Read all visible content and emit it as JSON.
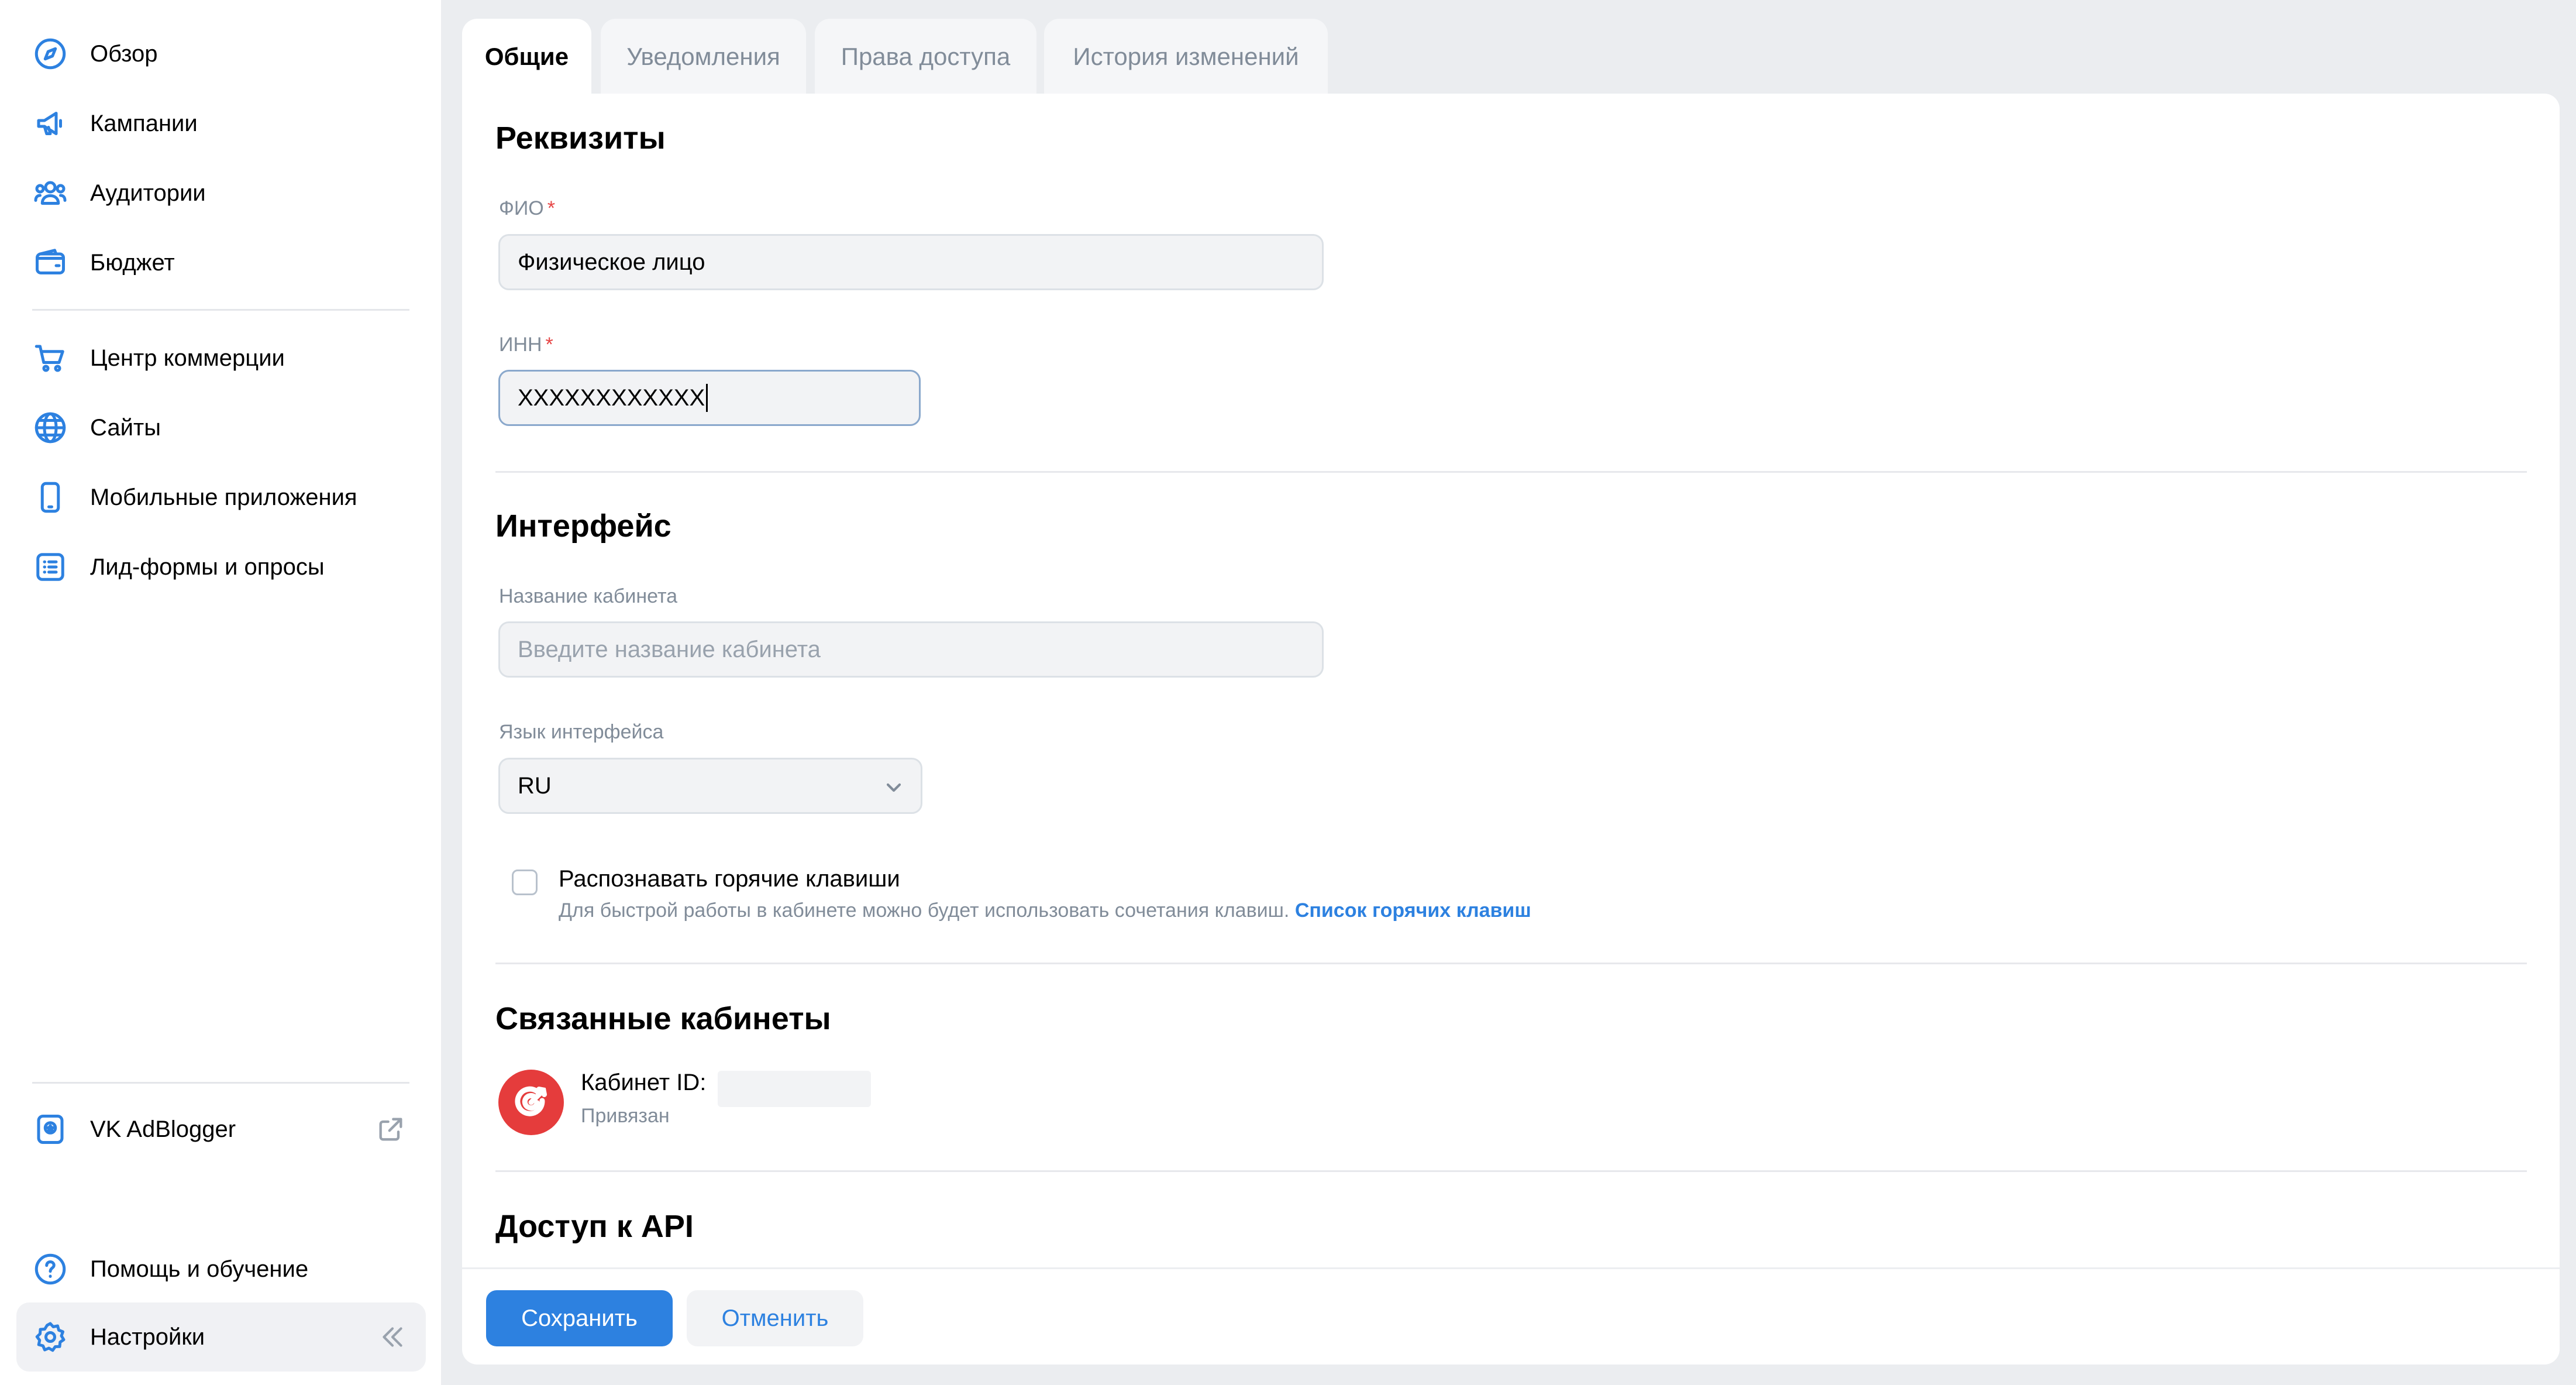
{
  "sidebar": {
    "items": [
      {
        "label": "Обзор",
        "icon": "compass-icon"
      },
      {
        "label": "Кампании",
        "icon": "megaphone-icon"
      },
      {
        "label": "Аудитории",
        "icon": "users-icon"
      },
      {
        "label": "Бюджет",
        "icon": "wallet-icon"
      },
      {
        "label": "Центр коммерции",
        "icon": "cart-icon"
      },
      {
        "label": "Сайты",
        "icon": "globe-icon"
      },
      {
        "label": "Мобильные приложения",
        "icon": "smartphone-icon"
      },
      {
        "label": "Лид-формы и опросы",
        "icon": "list-icon"
      }
    ],
    "adblogger": {
      "label": "VK AdBlogger",
      "icon": "adblogger-icon",
      "ext_icon": "external-link-icon"
    },
    "help": {
      "label": "Помощь и обучение",
      "icon": "question-icon"
    },
    "settings": {
      "label": "Настройки",
      "icon": "gear-icon",
      "collapse_icon": "chevrons-left-icon"
    }
  },
  "tabs": [
    {
      "label": "Общие",
      "active": true
    },
    {
      "label": "Уведомления",
      "active": false
    },
    {
      "label": "Права доступа",
      "active": false
    },
    {
      "label": "История изменений",
      "active": false
    }
  ],
  "requisites": {
    "title": "Реквизиты",
    "fio_label": "ФИО",
    "fio_value": "Физическое лицо",
    "inn_label": "ИНН",
    "inn_value": "XXXXXXXXXXXX",
    "required_mark": "*"
  },
  "interface": {
    "title": "Интерфейс",
    "cabinet_name_label": "Название кабинета",
    "cabinet_name_placeholder": "Введите название кабинета",
    "language_label": "Язык интерфейса",
    "language_value": "RU",
    "hotkeys_label": "Распознавать горячие клавиши",
    "hotkeys_hint": "Для быстрой работы в кабинете можно будет использовать сочетания клавиш.",
    "hotkeys_link": "Список горячих клавиш"
  },
  "linked": {
    "title": "Связанные кабинеты",
    "cabinet_id_label": "Кабинет ID:",
    "status": "Привязан"
  },
  "api": {
    "title": "Доступ к API"
  },
  "footer": {
    "save_label": "Сохранить",
    "cancel_label": "Отменить"
  },
  "colors": {
    "accent": "#2d81e0",
    "required": "#e64646",
    "avatar": "#e53c3c"
  }
}
